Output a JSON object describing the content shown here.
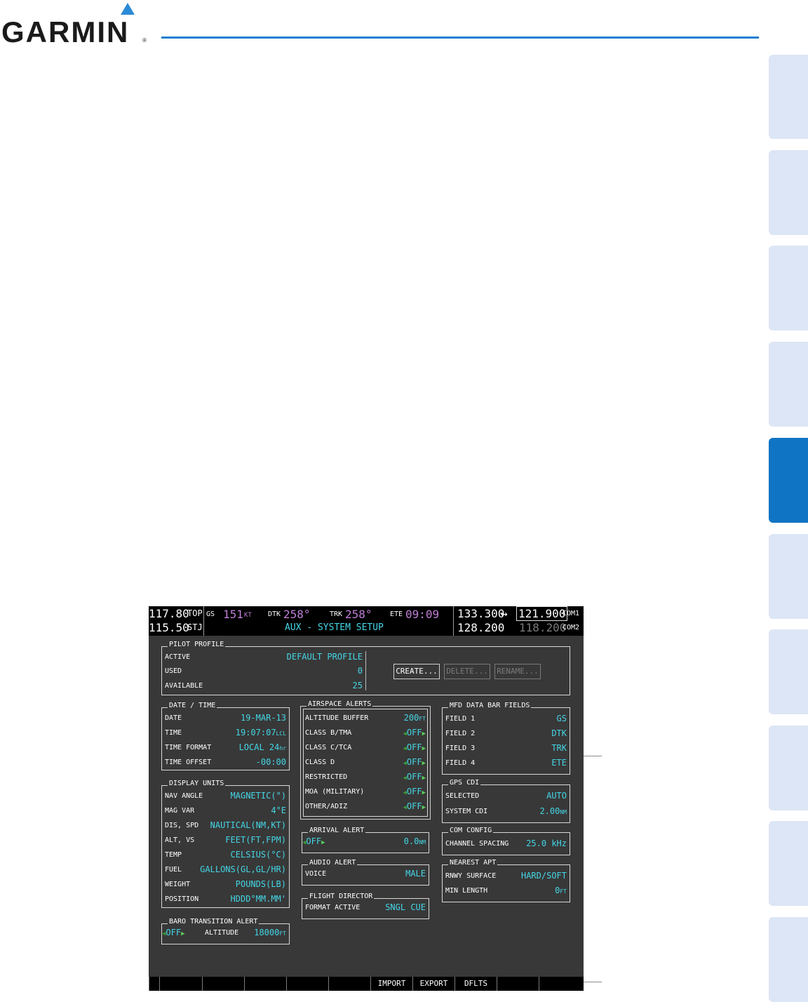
{
  "logo": {
    "text": "GARMIN",
    "reg": "®"
  },
  "status_bar": {
    "nav1_active": "117.80",
    "nav1_id": "TOP",
    "nav2_active": "115.50",
    "nav2_id": "STJ",
    "gs_label": "GS",
    "gs_value": "151",
    "gs_unit": "KT",
    "dtk_label": "DTK",
    "dtk_value": "258°",
    "trk_label": "TRK",
    "trk_value": "258°",
    "ete_label": "ETE",
    "ete_value": "09:09",
    "page_title": "AUX - SYSTEM SETUP",
    "com1_active": "133.300",
    "swap_arrow": "↔",
    "com1_standby": "121.900",
    "com1_label": "COM1",
    "com2_active": "128.200",
    "com2_standby": "118.200",
    "com2_label": "COM2"
  },
  "pilot_profile": {
    "title": "PILOT PROFILE",
    "active_label": "ACTIVE",
    "active_value": "DEFAULT PROFILE",
    "used_label": "USED",
    "used_value": "0",
    "available_label": "AVAILABLE",
    "available_value": "25",
    "create_label": "CREATE...",
    "delete_label": "DELETE...",
    "rename_label": "RENAME..."
  },
  "date_time": {
    "title": "DATE / TIME",
    "rows": [
      {
        "label": "DATE",
        "value": "19-MAR-13",
        "unit": ""
      },
      {
        "label": "TIME",
        "value": "19:07:07",
        "unit": "LCL"
      },
      {
        "label": "TIME FORMAT",
        "value": "LOCAL 24",
        "unit": "hr"
      },
      {
        "label": "TIME OFFSET",
        "value": "-00:00",
        "unit": ""
      }
    ]
  },
  "display_units": {
    "title": "DISPLAY UNITS",
    "rows": [
      {
        "label": "NAV ANGLE",
        "value": "MAGNETIC(°)"
      },
      {
        "label": "MAG VAR",
        "value": "4°E"
      },
      {
        "label": "DIS, SPD",
        "value": "NAUTICAL(NM,KT)"
      },
      {
        "label": "ALT, VS",
        "value": "FEET(FT,FPM)"
      },
      {
        "label": "TEMP",
        "value": "CELSIUS(°C)"
      },
      {
        "label": "FUEL",
        "value": "GALLONS(GL,GL/HR)"
      },
      {
        "label": "WEIGHT",
        "value": "POUNDS(LB)"
      },
      {
        "label": "POSITION",
        "value": "HDDD°MM.MM'"
      }
    ]
  },
  "baro_alert": {
    "title": "BARO TRANSITION ALERT",
    "state": "OFF",
    "altitude_label": "ALTITUDE",
    "altitude_value": "18000",
    "altitude_unit": "FT"
  },
  "airspace_alerts": {
    "title": "AIRSPACE ALERTS",
    "buffer_label": "ALTITUDE BUFFER",
    "buffer_value": "200",
    "buffer_unit": "FT",
    "rows": [
      {
        "label": "CLASS B/TMA",
        "value": "OFF"
      },
      {
        "label": "CLASS C/TCA",
        "value": "OFF"
      },
      {
        "label": "CLASS D",
        "value": "OFF"
      },
      {
        "label": "RESTRICTED",
        "value": "OFF"
      },
      {
        "label": "MOA (MILITARY)",
        "value": "OFF"
      },
      {
        "label": "OTHER/ADIZ",
        "value": "OFF"
      }
    ]
  },
  "arrival_alert": {
    "title": "ARRIVAL ALERT",
    "state": "OFF",
    "value": "0.0",
    "unit": "NM"
  },
  "audio_alert": {
    "title": "AUDIO ALERT",
    "label": "VOICE",
    "value": "MALE"
  },
  "flight_director": {
    "title": "FLIGHT DIRECTOR",
    "label": "FORMAT ACTIVE",
    "value": "SNGL CUE"
  },
  "mfd_fields": {
    "title": "MFD DATA BAR FIELDS",
    "rows": [
      {
        "label": "FIELD 1",
        "value": "GS"
      },
      {
        "label": "FIELD 2",
        "value": "DTK"
      },
      {
        "label": "FIELD 3",
        "value": "TRK"
      },
      {
        "label": "FIELD 4",
        "value": "ETE"
      }
    ]
  },
  "gps_cdi": {
    "title": "GPS CDI",
    "selected_label": "SELECTED",
    "selected_value": "AUTO",
    "system_label": "SYSTEM CDI",
    "system_value": "2.00",
    "system_unit": "NM"
  },
  "com_config": {
    "title": "COM CONFIG",
    "label": "CHANNEL SPACING",
    "value": "25.0 kHz"
  },
  "nearest_apt": {
    "title": "NEAREST APT",
    "surface_label": "RNWY SURFACE",
    "surface_value": "HARD/SOFT",
    "length_label": "MIN LENGTH",
    "length_value": "0",
    "length_unit": "FT"
  },
  "softkeys": [
    "",
    "",
    "",
    "",
    "",
    "IMPORT",
    "EXPORT",
    "DFLTS",
    "",
    "",
    ""
  ]
}
